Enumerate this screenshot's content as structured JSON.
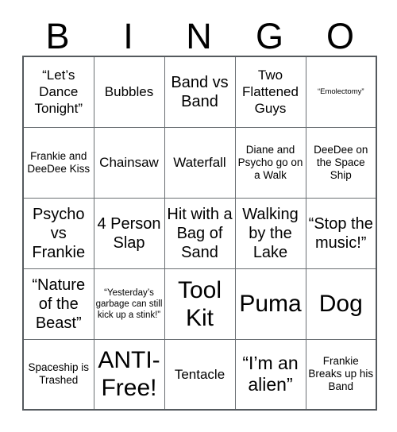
{
  "card": {
    "title": "BINGO",
    "header_letters": [
      "B",
      "I",
      "N",
      "G",
      "O"
    ],
    "columns": 5,
    "rows": 5,
    "border_color": "#6a6f73",
    "text_color": "#000000",
    "background_color": "#ffffff"
  },
  "cells": [
    [
      {
        "text": "“Let’s Dance Tonight”",
        "size": "md"
      },
      {
        "text": "Bubbles",
        "size": "md"
      },
      {
        "text": "Band vs Band",
        "size": "lg"
      },
      {
        "text": "Two Flattened Guys",
        "size": "md"
      },
      {
        "text": "“Emolectomy”",
        "size": "xs"
      }
    ],
    [
      {
        "text": "Frankie and DeeDee Kiss",
        "size": "smm"
      },
      {
        "text": "Chainsaw",
        "size": "md"
      },
      {
        "text": "Waterfall",
        "size": "md"
      },
      {
        "text": "Diane and Psycho go on a Walk",
        "size": "smm"
      },
      {
        "text": "DeeDee on the Space Ship",
        "size": "smm"
      }
    ],
    [
      {
        "text": "Psycho vs Frankie",
        "size": "lg"
      },
      {
        "text": "4 Person Slap",
        "size": "lg"
      },
      {
        "text": "Hit with a Bag of Sand",
        "size": "lg"
      },
      {
        "text": "Walking by the Lake",
        "size": "lg"
      },
      {
        "text": "“Stop the music!”",
        "size": "lg"
      }
    ],
    [
      {
        "text": "“Nature of the Beast”",
        "size": "lg"
      },
      {
        "text": "“Yesterday’s garbage can still kick up a stink!”",
        "size": "sm"
      },
      {
        "text": "Tool Kit",
        "size": "xxl"
      },
      {
        "text": "Puma",
        "size": "xxl"
      },
      {
        "text": "Dog",
        "size": "xxl"
      }
    ],
    [
      {
        "text": "Spaceship is Trashed",
        "size": "smm"
      },
      {
        "text": "ANTI-Free!",
        "size": "xxl"
      },
      {
        "text": "Tentacle",
        "size": "md"
      },
      {
        "text": "“I’m an alien”",
        "size": "xl"
      },
      {
        "text": "Frankie Breaks up his Band",
        "size": "smm"
      }
    ]
  ]
}
